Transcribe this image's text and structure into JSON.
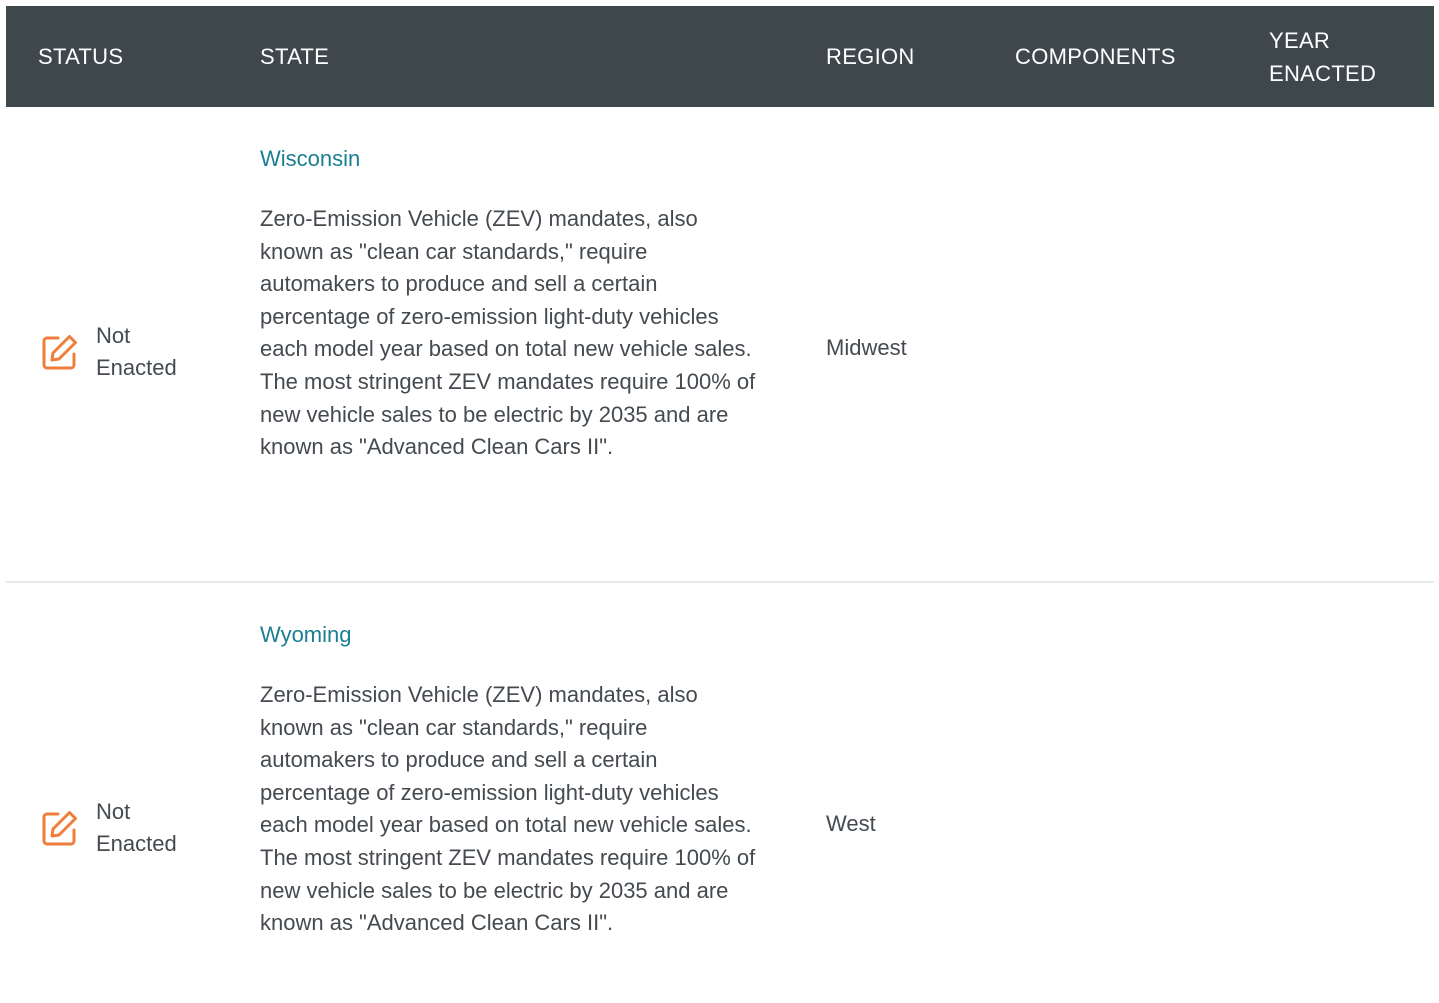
{
  "table": {
    "columns": [
      "STATUS",
      "STATE",
      "REGION",
      "COMPONENTS",
      "YEAR\nENACTED"
    ],
    "rows": [
      {
        "status_icon": "edit-icon",
        "status": "Not Enacted",
        "state": "Wisconsin",
        "description": "Zero-Emission Vehicle (ZEV) mandates, also known as \"clean car standards,\" require automakers to produce and sell a certain percentage of zero-emission light-duty vehicles each model year based on total new vehicle sales. The most stringent ZEV mandates require 100% of new vehicle sales to be electric by 2035 and are known as \"Advanced Clean Cars II\".",
        "region": "Midwest",
        "components": "",
        "year_enacted": ""
      },
      {
        "status_icon": "edit-icon",
        "status": "Not Enacted",
        "state": "Wyoming",
        "description": "Zero-Emission Vehicle (ZEV) mandates, also known as \"clean car standards,\" require automakers to produce and sell a certain percentage of zero-emission light-duty vehicles each model year based on total new vehicle sales. The most stringent ZEV mandates require 100% of new vehicle sales to be electric by 2035 and are known as \"Advanced Clean Cars II\".",
        "region": "West",
        "components": "",
        "year_enacted": ""
      }
    ]
  },
  "colors": {
    "header_bg": "#3d474c",
    "link": "#1b7f93",
    "icon": "#ef7d3c",
    "text": "#444a4f"
  }
}
